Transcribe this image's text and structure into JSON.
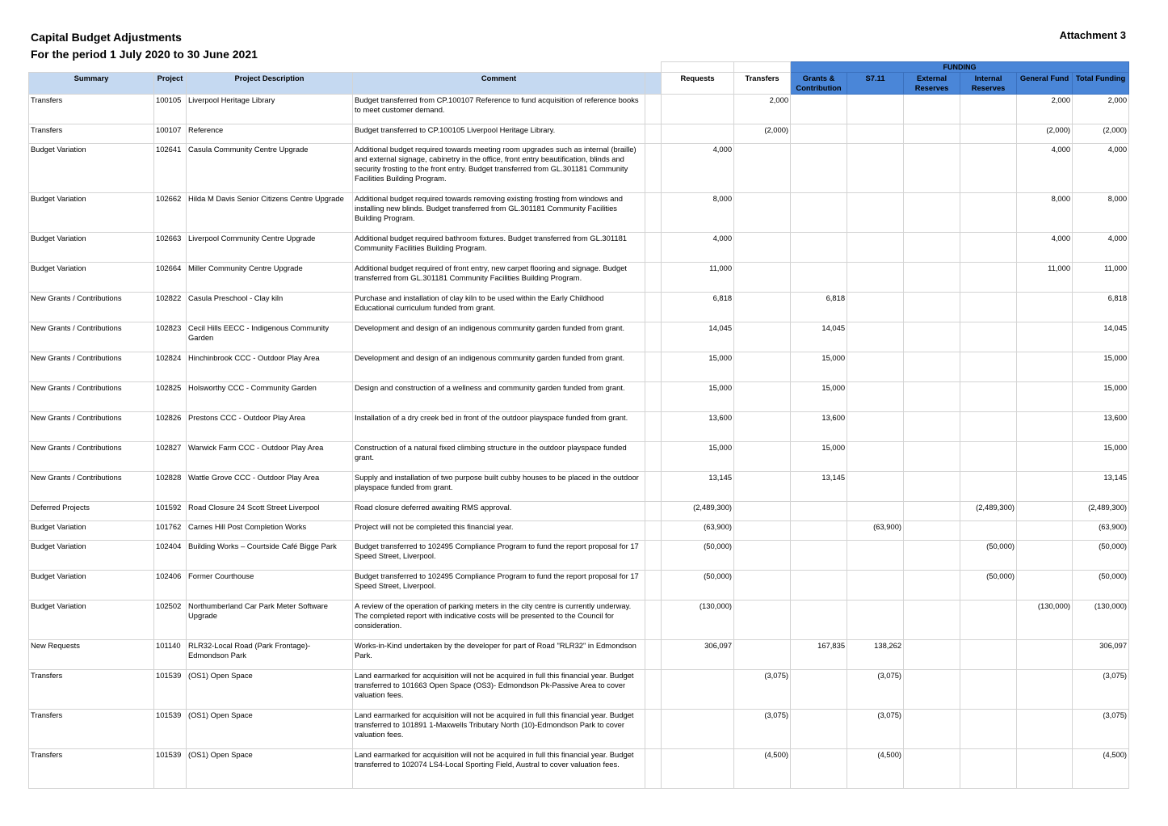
{
  "header": {
    "title": "Capital Budget Adjustments",
    "subtitle": "For the period 1 July 2020 to 30 June 2021",
    "attachment": "Attachment 3"
  },
  "columns": {
    "summary": "Summary",
    "project": "Project",
    "description": "Project Description",
    "comment": "Comment",
    "requests": "Requests",
    "transfers": "Transfers",
    "funding": "FUNDING",
    "grants": "Grants & Contribution",
    "s711": "S7.11",
    "external": "External Reserves",
    "internal": "Internal Reserves",
    "general": "General Fund",
    "total": "Total Funding"
  },
  "rows": [
    {
      "summary": "Transfers",
      "project": "100105",
      "description": "Liverpool Heritage Library",
      "comment": "Budget transferred from CP.100107 Reference to fund acquisition of reference books to meet customer demand.",
      "requests": "",
      "transfers": "2,000",
      "grants": "",
      "s711": "",
      "external": "",
      "internal": "",
      "general": "2,000",
      "total": "2,000"
    },
    {
      "summary": "Transfers",
      "project": "100107",
      "description": "Reference",
      "comment": "Budget transferred to CP.100105 Liverpool Heritage Library.",
      "requests": "",
      "transfers": "(2,000)",
      "grants": "",
      "s711": "",
      "external": "",
      "internal": "",
      "general": "(2,000)",
      "total": "(2,000)"
    },
    {
      "summary": "Budget Variation",
      "project": "102641",
      "description": "Casula Community Centre Upgrade",
      "comment": "Additional budget required towards meeting room upgrades such as internal (braille) and external signage, cabinetry in the office, front entry beautification, blinds and security frosting to the front entry.  Budget transferred from GL.301181 Community Facilities Building Program.",
      "requests": "4,000",
      "transfers": "",
      "grants": "",
      "s711": "",
      "external": "",
      "internal": "",
      "general": "4,000",
      "total": "4,000"
    },
    {
      "summary": "Budget Variation",
      "project": "102662",
      "description": "Hilda M Davis Senior Citizens Centre Upgrade",
      "comment": "Additional budget required towards removing existing frosting from windows and installing new blinds. Budget transferred from GL.301181 Community Facilities Building Program.",
      "requests": "8,000",
      "transfers": "",
      "grants": "",
      "s711": "",
      "external": "",
      "internal": "",
      "general": "8,000",
      "total": "8,000"
    },
    {
      "summary": "Budget Variation",
      "project": "102663",
      "description": "Liverpool Community Centre Upgrade",
      "comment": "Additional budget required bathroom fixtures. Budget transferred from GL.301181 Community Facilities Building Program.",
      "requests": "4,000",
      "transfers": "",
      "grants": "",
      "s711": "",
      "external": "",
      "internal": "",
      "general": "4,000",
      "total": "4,000"
    },
    {
      "summary": "Budget Variation",
      "project": "102664",
      "description": "Miller Community Centre Upgrade",
      "comment": "Additional budget required of front entry, new carpet flooring and signage. Budget transferred from GL.301181 Community Facilities Building Program.",
      "requests": "11,000",
      "transfers": "",
      "grants": "",
      "s711": "",
      "external": "",
      "internal": "",
      "general": "11,000",
      "total": "11,000"
    },
    {
      "summary": "New Grants / Contributions",
      "project": "102822",
      "description": "Casula Preschool - Clay kiln",
      "comment": "Purchase and installation of clay kiln to be used within the Early Childhood Educational curriculum funded from grant.",
      "requests": "6,818",
      "transfers": "",
      "grants": "6,818",
      "s711": "",
      "external": "",
      "internal": "",
      "general": "",
      "total": "6,818"
    },
    {
      "summary": "New Grants / Contributions",
      "project": "102823",
      "description": "Cecil Hills EECC - Indigenous Community Garden",
      "comment": "Development and design of an indigenous community garden funded from grant.",
      "requests": "14,045",
      "transfers": "",
      "grants": "14,045",
      "s711": "",
      "external": "",
      "internal": "",
      "general": "",
      "total": "14,045"
    },
    {
      "summary": "New Grants / Contributions",
      "project": "102824",
      "description": "Hinchinbrook CCC - Outdoor Play Area",
      "comment": "Development and design of an indigenous community garden funded from grant.",
      "requests": "15,000",
      "transfers": "",
      "grants": "15,000",
      "s711": "",
      "external": "",
      "internal": "",
      "general": "",
      "total": "15,000"
    },
    {
      "summary": "New Grants / Contributions",
      "project": "102825",
      "description": "Holsworthy CCC - Community Garden",
      "comment": "Design and construction of a wellness and community garden funded from grant.",
      "requests": "15,000",
      "transfers": "",
      "grants": "15,000",
      "s711": "",
      "external": "",
      "internal": "",
      "general": "",
      "total": "15,000"
    },
    {
      "summary": "New Grants / Contributions",
      "project": "102826",
      "description": "Prestons CCC - Outdoor Play Area",
      "comment": "Installation of a dry creek bed in front of the outdoor playspace funded from grant.",
      "requests": "13,600",
      "transfers": "",
      "grants": "13,600",
      "s711": "",
      "external": "",
      "internal": "",
      "general": "",
      "total": "13,600"
    },
    {
      "summary": "New Grants / Contributions",
      "project": "102827",
      "description": "Warwick Farm CCC - Outdoor Play Area",
      "comment": "Construction of a natural fixed climbing structure in the outdoor playspace funded grant.",
      "requests": "15,000",
      "transfers": "",
      "grants": "15,000",
      "s711": "",
      "external": "",
      "internal": "",
      "general": "",
      "total": "15,000"
    },
    {
      "summary": "New Grants / Contributions",
      "project": "102828",
      "description": "Wattle Grove CCC - Outdoor Play Area",
      "comment": "Supply and installation of two purpose built cubby houses to be placed in the outdoor playspace funded from grant.",
      "requests": "13,145",
      "transfers": "",
      "grants": "13,145",
      "s711": "",
      "external": "",
      "internal": "",
      "general": "",
      "total": "13,145"
    },
    {
      "summary": "Deferred Projects",
      "project": "101592",
      "description": "Road Closure 24 Scott Street Liverpool",
      "comment": "Road closure deferred awaiting RMS approval.",
      "requests": "(2,489,300)",
      "transfers": "",
      "grants": "",
      "s711": "",
      "external": "",
      "internal": "(2,489,300)",
      "general": "",
      "total": "(2,489,300)"
    },
    {
      "summary": "Budget Variation",
      "project": "101762",
      "description": "Carnes Hill Post Completion Works",
      "comment": "Project will not be completed this financial year.",
      "requests": "(63,900)",
      "transfers": "",
      "grants": "",
      "s711": "(63,900)",
      "external": "",
      "internal": "",
      "general": "",
      "total": "(63,900)"
    },
    {
      "summary": "Budget Variation",
      "project": "102404",
      "description": "Building Works – Courtside Café Bigge Park",
      "comment": "Budget transferred to 102495 Compliance Program to fund the report proposal for 17 Speed Street, Liverpool.",
      "requests": "(50,000)",
      "transfers": "",
      "grants": "",
      "s711": "",
      "external": "",
      "internal": "(50,000)",
      "general": "",
      "total": "(50,000)"
    },
    {
      "summary": "Budget Variation",
      "project": "102406",
      "description": "Former Courthouse",
      "comment": "Budget transferred to 102495 Compliance Program to fund the report proposal for 17 Speed Street, Liverpool.",
      "requests": "(50,000)",
      "transfers": "",
      "grants": "",
      "s711": "",
      "external": "",
      "internal": "(50,000)",
      "general": "",
      "total": "(50,000)"
    },
    {
      "summary": "Budget Variation",
      "project": "102502",
      "description": "Northumberland Car Park Meter Software Upgrade",
      "comment": "A review of the operation of parking meters in the city centre is currently underway.  The completed report with indicative costs will be presented to the Council for consideration.",
      "requests": "(130,000)",
      "transfers": "",
      "grants": "",
      "s711": "",
      "external": "",
      "internal": "",
      "general": "(130,000)",
      "total": "(130,000)"
    },
    {
      "summary": "New Requests",
      "project": "101140",
      "description": "RLR32-Local Road (Park Frontage)-Edmondson Park",
      "comment": "Works-in-Kind undertaken by the developer for part of Road \"RLR32\" in Edmondson Park.",
      "requests": "306,097",
      "transfers": "",
      "grants": "167,835",
      "s711": "138,262",
      "external": "",
      "internal": "",
      "general": "",
      "total": "306,097"
    },
    {
      "summary": "Transfers",
      "project": "101539",
      "description": "(OS1) Open Space",
      "comment": "Land earmarked for acquisition will not be acquired in full this financial year. Budget transferred to 101663 Open Space (OS3)- Edmondson Pk-Passive Area to cover valuation fees.",
      "requests": "",
      "transfers": "(3,075)",
      "grants": "",
      "s711": "(3,075)",
      "external": "",
      "internal": "",
      "general": "",
      "total": "(3,075)"
    },
    {
      "summary": "Transfers",
      "project": "101539",
      "description": "(OS1) Open Space",
      "comment": "Land earmarked for acquisition will not be acquired in full this financial year. Budget transferred to 101891 1-Maxwells Tributary North (10)-Edmondson Park to cover valuation fees.",
      "requests": "",
      "transfers": "(3,075)",
      "grants": "",
      "s711": "(3,075)",
      "external": "",
      "internal": "",
      "general": "",
      "total": "(3,075)"
    },
    {
      "summary": "Transfers",
      "project": "101539",
      "description": "(OS1) Open Space",
      "comment": "Land earmarked for acquisition will not be acquired in full this financial year. Budget transferred to 102074 LS4-Local Sporting Field, Austral to cover valuation fees.",
      "requests": "",
      "transfers": "(4,500)",
      "grants": "",
      "s711": "(4,500)",
      "external": "",
      "internal": "",
      "general": "",
      "total": "(4,500)"
    }
  ],
  "row_heights": []
}
